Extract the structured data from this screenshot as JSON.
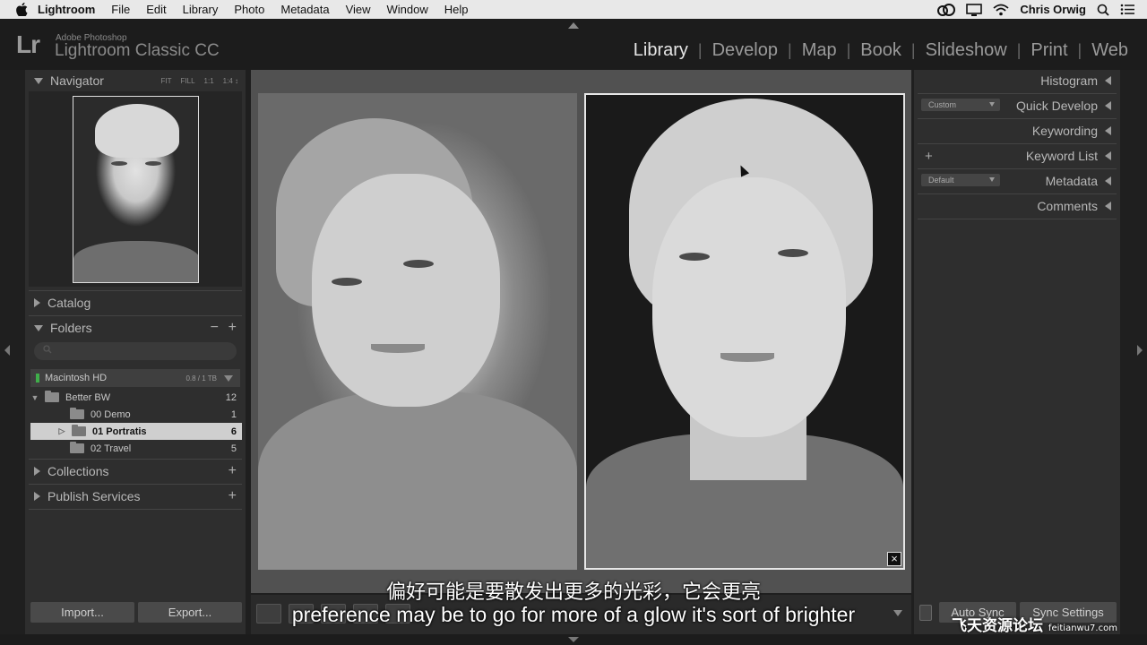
{
  "menubar": {
    "app": "Lightroom",
    "items": [
      "File",
      "Edit",
      "Library",
      "Photo",
      "Metadata",
      "View",
      "Window",
      "Help"
    ],
    "user": "Chris Orwig"
  },
  "identity": {
    "logo": "Lr",
    "line1": "Adobe Photoshop",
    "line2": "Lightroom Classic CC"
  },
  "modules": [
    "Library",
    "Develop",
    "Map",
    "Book",
    "Slideshow",
    "Print",
    "Web"
  ],
  "left_panel": {
    "navigator": {
      "title": "Navigator",
      "options": [
        "FIT",
        "FILL",
        "1:1",
        "1:4 ↕"
      ]
    },
    "catalog": "Catalog",
    "folders": {
      "title": "Folders",
      "volume": {
        "name": "Macintosh HD",
        "capacity": "0.8 / 1 TB"
      },
      "items": [
        {
          "name": "Better BW",
          "count": "12"
        },
        {
          "name": "00 Demo",
          "count": "1"
        },
        {
          "name": "01 Portratis",
          "count": "6"
        },
        {
          "name": "02 Travel",
          "count": "5"
        }
      ]
    },
    "collections": "Collections",
    "publish": "Publish Services",
    "import": "Import...",
    "export": "Export..."
  },
  "right_panel": {
    "histogram": "Histogram",
    "quick_develop": {
      "title": "Quick Develop",
      "preset": "Custom"
    },
    "keywording": "Keywording",
    "keyword_list": "Keyword List",
    "metadata": {
      "title": "Metadata",
      "preset": "Default"
    },
    "comments": "Comments",
    "auto_sync": "Auto Sync",
    "sync_settings": "Sync Settings"
  },
  "subtitles": {
    "zh": "偏好可能是要散发出更多的光彩，它会更亮",
    "en": "preference may be to go for more of a glow it's sort of brighter"
  },
  "watermark": {
    "cn": "飞天资源论坛",
    "site": "feitianwu7.com"
  }
}
